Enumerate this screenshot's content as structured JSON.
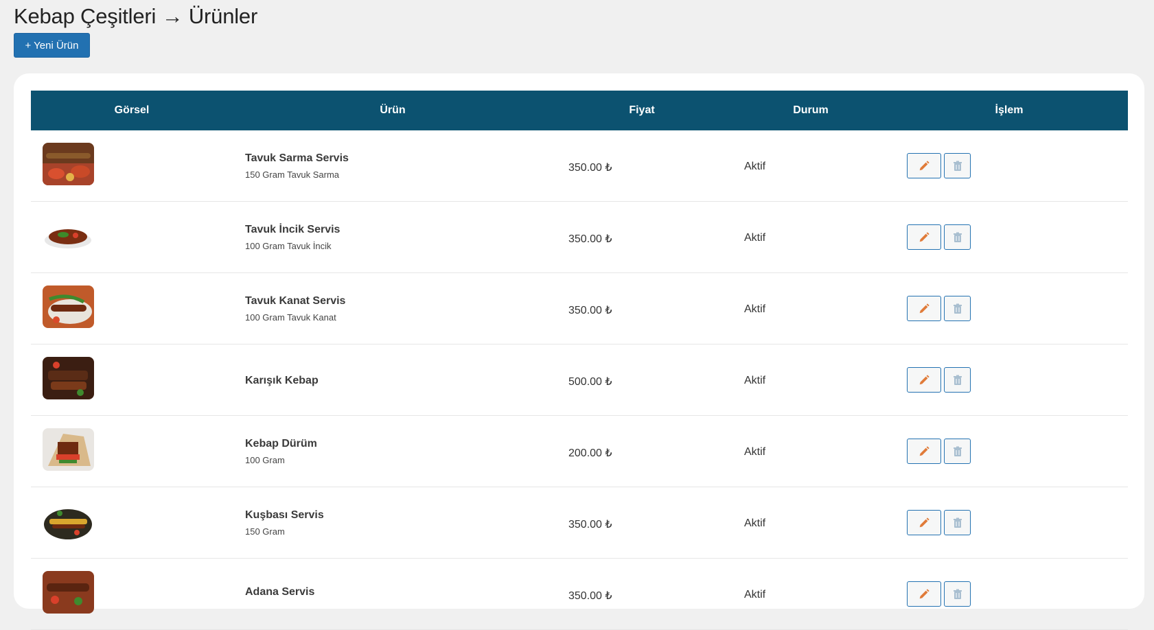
{
  "page": {
    "title": "Kebap Çeşitleri → Ürünler",
    "new_button": "+ Yeni Ürün"
  },
  "table": {
    "headers": {
      "image": "Görsel",
      "product": "Ürün",
      "price": "Fiyat",
      "status": "Durum",
      "action": "İşlem"
    },
    "rows": [
      {
        "name": "Tavuk Sarma Servis",
        "desc": "150 Gram Tavuk Sarma",
        "price": "350.00 ₺",
        "status": "Aktif"
      },
      {
        "name": "Tavuk İncik Servis",
        "desc": "100 Gram Tavuk İncik",
        "price": "350.00 ₺",
        "status": "Aktif"
      },
      {
        "name": "Tavuk Kanat Servis",
        "desc": "100 Gram Tavuk Kanat",
        "price": "350.00 ₺",
        "status": "Aktif"
      },
      {
        "name": "Karışık Kebap",
        "desc": "",
        "price": "500.00 ₺",
        "status": "Aktif"
      },
      {
        "name": "Kebap Dürüm",
        "desc": "100 Gram",
        "price": "200.00 ₺",
        "status": "Aktif"
      },
      {
        "name": "Kuşbası Servis",
        "desc": "150 Gram",
        "price": "350.00 ₺",
        "status": "Aktif"
      },
      {
        "name": "Adana Servis",
        "desc": "",
        "price": "350.00 ₺",
        "status": "Aktif"
      }
    ]
  },
  "colors": {
    "accent": "#2271b1",
    "header_bg": "#0c5270",
    "edit_icon": "#e07b39"
  },
  "icons": {
    "edit": "pencil-icon",
    "delete": "trash-icon"
  }
}
